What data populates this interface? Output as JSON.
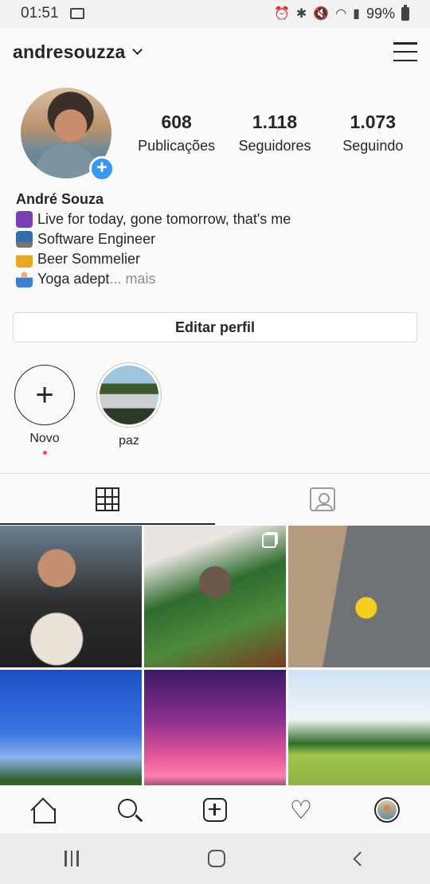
{
  "status_bar": {
    "time": "01:51",
    "battery": "99%"
  },
  "header": {
    "username": "andresouzza"
  },
  "profile": {
    "stats": [
      {
        "number": "608",
        "label": "Publicações"
      },
      {
        "number": "1.118",
        "label": "Seguidores"
      },
      {
        "number": "1.073",
        "label": "Seguindo"
      }
    ],
    "name": "André Souza",
    "bio_lines": [
      {
        "emoji": "yin-yang",
        "text": "Live for today, gone tomorrow, that's me"
      },
      {
        "emoji": "laptop",
        "text": "Software Engineer"
      },
      {
        "emoji": "beer-mug",
        "text": "Beer Sommelier"
      },
      {
        "emoji": "person-in-lotus-position",
        "text": "Yoga adept"
      }
    ],
    "bio_more": "... mais",
    "edit_button": "Editar perfil"
  },
  "highlights": [
    {
      "label": "Novo",
      "icon": "plus-icon"
    },
    {
      "label": "paz",
      "icon": "photo"
    }
  ],
  "tabs": [
    {
      "name": "grid",
      "icon": "grid-icon",
      "active": true
    },
    {
      "name": "tagged",
      "icon": "tagged-person-icon",
      "active": false
    }
  ],
  "posts": [
    {
      "subject": "selfie in car with dog"
    },
    {
      "subject": "plants and buddha statue",
      "multiple": true
    },
    {
      "subject": "yellow bike on sidewalk"
    },
    {
      "subject": "city skyline blue sky"
    },
    {
      "subject": "pink sunset sky"
    },
    {
      "subject": "bicycle on grass field"
    }
  ],
  "bottom_nav": [
    "home-icon",
    "search-icon",
    "new-post-icon",
    "activity-heart-icon",
    "profile-avatar"
  ],
  "colors": {
    "accent": "#3897f0",
    "notification_dot": "#ed4956"
  }
}
